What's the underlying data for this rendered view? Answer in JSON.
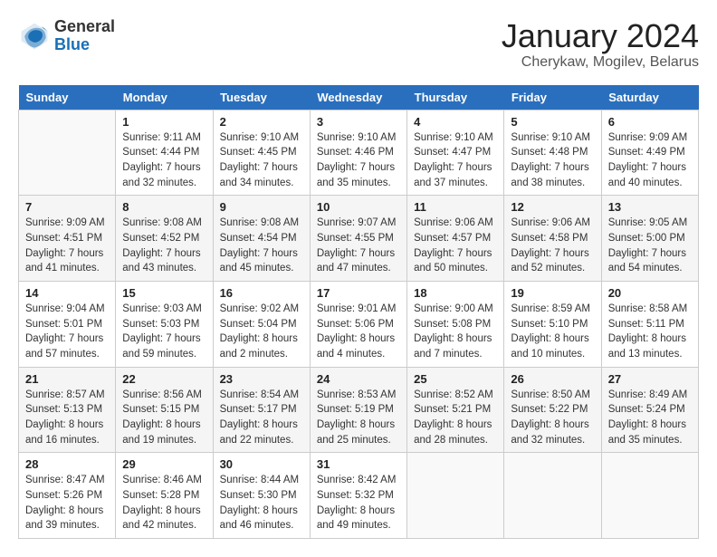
{
  "header": {
    "logo_general": "General",
    "logo_blue": "Blue",
    "title": "January 2024",
    "subtitle": "Cherykaw, Mogilev, Belarus"
  },
  "days_of_week": [
    "Sunday",
    "Monday",
    "Tuesday",
    "Wednesday",
    "Thursday",
    "Friday",
    "Saturday"
  ],
  "weeks": [
    [
      {
        "day": "",
        "info": ""
      },
      {
        "day": "1",
        "info": "Sunrise: 9:11 AM\nSunset: 4:44 PM\nDaylight: 7 hours\nand 32 minutes."
      },
      {
        "day": "2",
        "info": "Sunrise: 9:10 AM\nSunset: 4:45 PM\nDaylight: 7 hours\nand 34 minutes."
      },
      {
        "day": "3",
        "info": "Sunrise: 9:10 AM\nSunset: 4:46 PM\nDaylight: 7 hours\nand 35 minutes."
      },
      {
        "day": "4",
        "info": "Sunrise: 9:10 AM\nSunset: 4:47 PM\nDaylight: 7 hours\nand 37 minutes."
      },
      {
        "day": "5",
        "info": "Sunrise: 9:10 AM\nSunset: 4:48 PM\nDaylight: 7 hours\nand 38 minutes."
      },
      {
        "day": "6",
        "info": "Sunrise: 9:09 AM\nSunset: 4:49 PM\nDaylight: 7 hours\nand 40 minutes."
      }
    ],
    [
      {
        "day": "7",
        "info": "Sunrise: 9:09 AM\nSunset: 4:51 PM\nDaylight: 7 hours\nand 41 minutes."
      },
      {
        "day": "8",
        "info": "Sunrise: 9:08 AM\nSunset: 4:52 PM\nDaylight: 7 hours\nand 43 minutes."
      },
      {
        "day": "9",
        "info": "Sunrise: 9:08 AM\nSunset: 4:54 PM\nDaylight: 7 hours\nand 45 minutes."
      },
      {
        "day": "10",
        "info": "Sunrise: 9:07 AM\nSunset: 4:55 PM\nDaylight: 7 hours\nand 47 minutes."
      },
      {
        "day": "11",
        "info": "Sunrise: 9:06 AM\nSunset: 4:57 PM\nDaylight: 7 hours\nand 50 minutes."
      },
      {
        "day": "12",
        "info": "Sunrise: 9:06 AM\nSunset: 4:58 PM\nDaylight: 7 hours\nand 52 minutes."
      },
      {
        "day": "13",
        "info": "Sunrise: 9:05 AM\nSunset: 5:00 PM\nDaylight: 7 hours\nand 54 minutes."
      }
    ],
    [
      {
        "day": "14",
        "info": "Sunrise: 9:04 AM\nSunset: 5:01 PM\nDaylight: 7 hours\nand 57 minutes."
      },
      {
        "day": "15",
        "info": "Sunrise: 9:03 AM\nSunset: 5:03 PM\nDaylight: 7 hours\nand 59 minutes."
      },
      {
        "day": "16",
        "info": "Sunrise: 9:02 AM\nSunset: 5:04 PM\nDaylight: 8 hours\nand 2 minutes."
      },
      {
        "day": "17",
        "info": "Sunrise: 9:01 AM\nSunset: 5:06 PM\nDaylight: 8 hours\nand 4 minutes."
      },
      {
        "day": "18",
        "info": "Sunrise: 9:00 AM\nSunset: 5:08 PM\nDaylight: 8 hours\nand 7 minutes."
      },
      {
        "day": "19",
        "info": "Sunrise: 8:59 AM\nSunset: 5:10 PM\nDaylight: 8 hours\nand 10 minutes."
      },
      {
        "day": "20",
        "info": "Sunrise: 8:58 AM\nSunset: 5:11 PM\nDaylight: 8 hours\nand 13 minutes."
      }
    ],
    [
      {
        "day": "21",
        "info": "Sunrise: 8:57 AM\nSunset: 5:13 PM\nDaylight: 8 hours\nand 16 minutes."
      },
      {
        "day": "22",
        "info": "Sunrise: 8:56 AM\nSunset: 5:15 PM\nDaylight: 8 hours\nand 19 minutes."
      },
      {
        "day": "23",
        "info": "Sunrise: 8:54 AM\nSunset: 5:17 PM\nDaylight: 8 hours\nand 22 minutes."
      },
      {
        "day": "24",
        "info": "Sunrise: 8:53 AM\nSunset: 5:19 PM\nDaylight: 8 hours\nand 25 minutes."
      },
      {
        "day": "25",
        "info": "Sunrise: 8:52 AM\nSunset: 5:21 PM\nDaylight: 8 hours\nand 28 minutes."
      },
      {
        "day": "26",
        "info": "Sunrise: 8:50 AM\nSunset: 5:22 PM\nDaylight: 8 hours\nand 32 minutes."
      },
      {
        "day": "27",
        "info": "Sunrise: 8:49 AM\nSunset: 5:24 PM\nDaylight: 8 hours\nand 35 minutes."
      }
    ],
    [
      {
        "day": "28",
        "info": "Sunrise: 8:47 AM\nSunset: 5:26 PM\nDaylight: 8 hours\nand 39 minutes."
      },
      {
        "day": "29",
        "info": "Sunrise: 8:46 AM\nSunset: 5:28 PM\nDaylight: 8 hours\nand 42 minutes."
      },
      {
        "day": "30",
        "info": "Sunrise: 8:44 AM\nSunset: 5:30 PM\nDaylight: 8 hours\nand 46 minutes."
      },
      {
        "day": "31",
        "info": "Sunrise: 8:42 AM\nSunset: 5:32 PM\nDaylight: 8 hours\nand 49 minutes."
      },
      {
        "day": "",
        "info": ""
      },
      {
        "day": "",
        "info": ""
      },
      {
        "day": "",
        "info": ""
      }
    ]
  ]
}
